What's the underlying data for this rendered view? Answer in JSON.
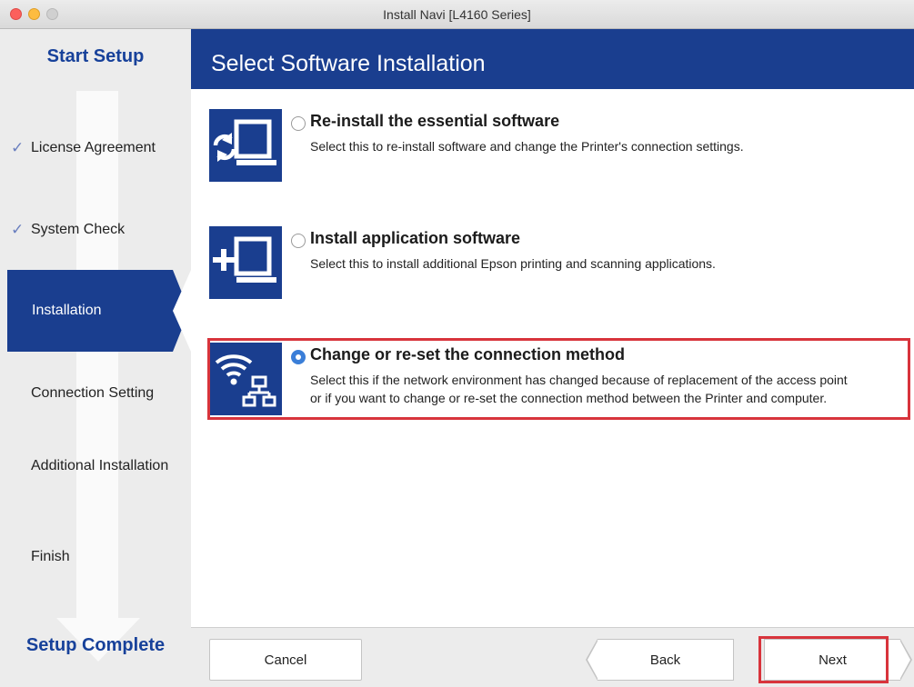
{
  "window": {
    "title": "Install Navi [L4160 Series]"
  },
  "sidebar": {
    "start_label": "Start Setup",
    "end_label": "Setup Complete",
    "steps": [
      {
        "label": "License Agreement",
        "status": "done"
      },
      {
        "label": "System Check",
        "status": "done"
      },
      {
        "label": "Installation",
        "status": "active"
      },
      {
        "label": "Connection Setting",
        "status": "pending"
      },
      {
        "label": "Additional Installation",
        "status": "pending"
      },
      {
        "label": "Finish",
        "status": "pending"
      }
    ]
  },
  "main": {
    "title": "Select Software Installation",
    "options": [
      {
        "title": "Re-install the essential software",
        "desc1": "Select this to re-install software and change the Printer's connection settings.",
        "desc2": "",
        "icon": "reinstall-icon",
        "selected": false
      },
      {
        "title": "Install application software",
        "desc1": "Select this to install additional Epson printing and scanning applications.",
        "desc2": "",
        "icon": "add-software-icon",
        "selected": false
      },
      {
        "title": "Change or re-set the connection method",
        "desc1": "Select this if the network environment has changed because of replacement of the access point",
        "desc2": "or if you want to change or re-set the connection method between the Printer and computer.",
        "icon": "network-connection-icon",
        "selected": true
      }
    ]
  },
  "footer": {
    "cancel_label": "Cancel",
    "back_label": "Back",
    "next_label": "Next"
  },
  "colors": {
    "brand_blue": "#1a3e8f",
    "highlight_red": "#d8343c",
    "radio_blue": "#3a7ed8"
  }
}
